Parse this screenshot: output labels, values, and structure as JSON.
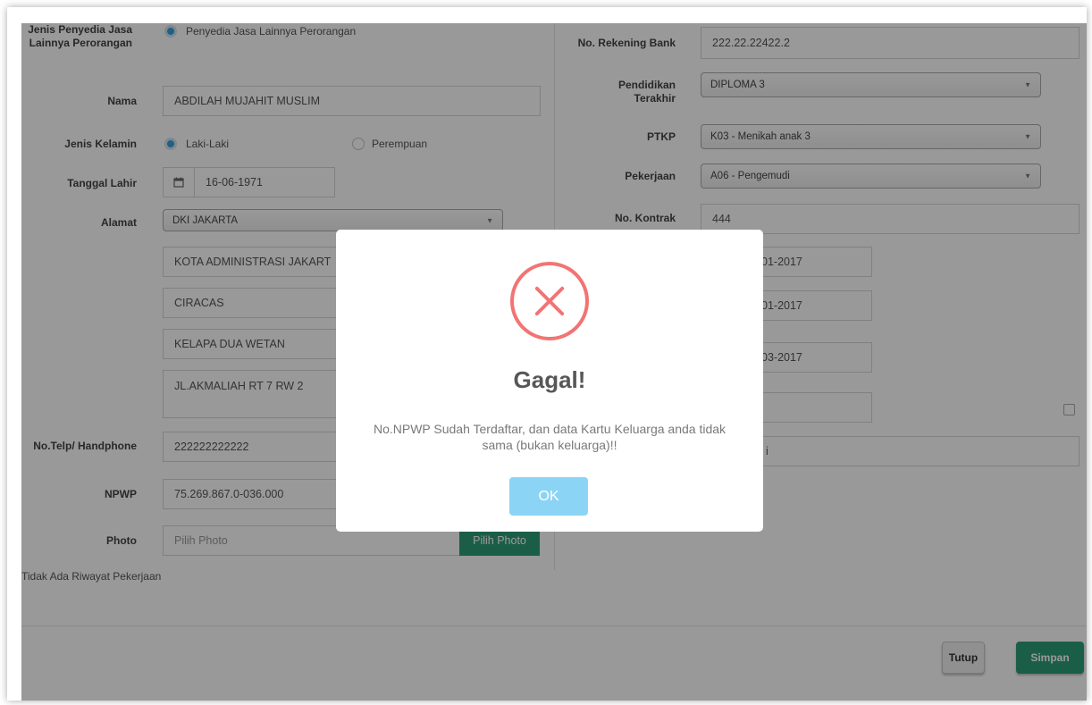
{
  "left": {
    "jenis_label": "Jenis Penyedia Jasa Lainnya Perorangan",
    "jenis_option": "Penyedia Jasa Lainnya Perorangan",
    "nama_label": "Nama",
    "nama_value": "ABDILAH MUJAHIT MUSLIM",
    "kelamin_label": "Jenis Kelamin",
    "kelamin_opt1": "Laki-Laki",
    "kelamin_opt2": "Perempuan",
    "tgl_label": "Tanggal Lahir",
    "tgl_value": "16-06-1971",
    "alamat_label": "Alamat",
    "provinsi": "DKI JAKARTA",
    "kota": "KOTA ADMINISTRASI JAKART",
    "kecamatan": "CIRACAS",
    "kelurahan": "KELAPA DUA WETAN",
    "alamat_detail": "JL.AKMALIAH RT 7 RW 2",
    "telp_label": "No.Telp/ Handphone",
    "telp_value": "222222222222",
    "npwp_label": "NPWP",
    "npwp_value": "75.269.867.0-036.000",
    "photo_label": "Photo",
    "photo_placeholder": "Pilih Photo",
    "photo_button": "Pilih Photo",
    "riwayat_text": "Tidak Ada Riwayat Pekerjaan"
  },
  "right": {
    "rekening_label": "No. Rekening Bank",
    "rekening_value": "222.22.22422.2",
    "pendidikan_label": "Pendidikan Terakhir",
    "pendidikan_value": "DIPLOMA 3",
    "ptkp_label": "PTKP",
    "ptkp_value": "K03 - Menikah anak 3",
    "pekerjaan_label": "Pekerjaan",
    "pekerjaan_value": "A06 - Pengemudi",
    "kontrak_label": "No. Kontrak",
    "kontrak_value": "444",
    "date1_partial": "01-2017",
    "date2_partial": "01-2017",
    "date3_partial": "03-2017",
    "field_partial": "i"
  },
  "footer": {
    "tutup": "Tutup",
    "simpan": "Simpan"
  },
  "dialog": {
    "title": "Gagal!",
    "message": "No.NPWP Sudah Terdaftar, dan data Kartu Keluarga anda tidak sama (bukan keluarga)!!",
    "ok": "OK"
  },
  "colors": {
    "accent_green": "#2d9d78",
    "radio_blue": "#3b9fd8",
    "error_red": "#f27474",
    "ok_blue": "#8cd4f5"
  }
}
